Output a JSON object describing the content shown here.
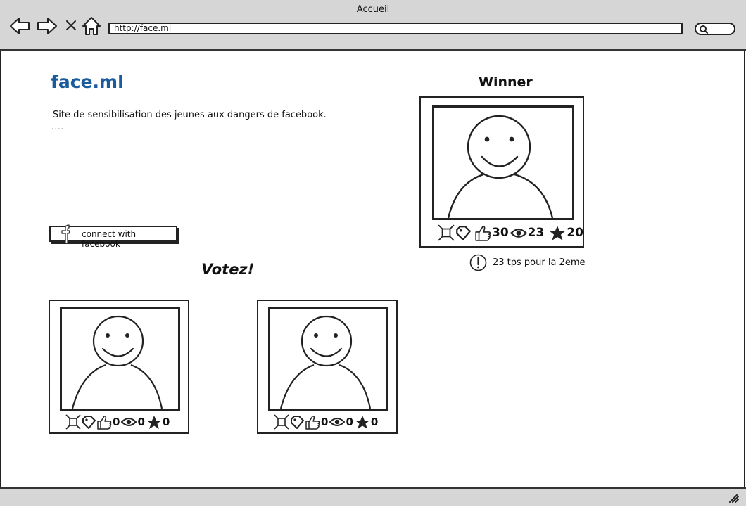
{
  "window": {
    "title": "Accueil"
  },
  "browser": {
    "url": "http://face.ml"
  },
  "site": {
    "title": "face.ml",
    "description": "Site de sensibilisation des jeunes aux dangers de facebook.",
    "ellipsis": "....",
    "connect_label": "connect with facebook"
  },
  "winner": {
    "heading": "Winner",
    "likes": "30",
    "views": "23",
    "stars": "20",
    "notice": "23 tps pour la 2eme"
  },
  "votez": {
    "heading": "Votez!",
    "cards": [
      {
        "likes": "0",
        "views": "0",
        "stars": "0"
      },
      {
        "likes": "0",
        "views": "0",
        "stars": "0"
      }
    ]
  },
  "icons": {
    "back": "arrow-left-icon",
    "forward": "arrow-right-icon",
    "stop": "close-icon",
    "home": "home-icon",
    "search": "search-icon",
    "crop": "crop-icon",
    "tag": "tag-icon",
    "like": "thumbs-up-icon",
    "views": "eye-icon",
    "star": "star-icon",
    "alert": "alert-icon",
    "facebook": "facebook-icon"
  }
}
